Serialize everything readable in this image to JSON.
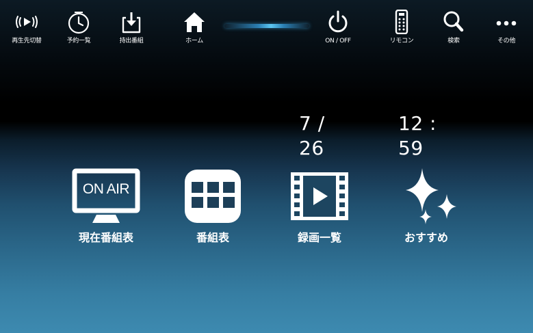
{
  "toolbar": {
    "playback_switch": {
      "label": "再生先切替",
      "icon": "playback-switch-icon"
    },
    "reservation_list": {
      "label": "予約一覧",
      "icon": "clock-icon"
    },
    "take_out": {
      "label": "持出番組",
      "icon": "export-icon"
    },
    "home": {
      "label": "ホーム",
      "icon": "home-icon"
    },
    "power": {
      "label": "ON / OFF",
      "icon": "power-icon"
    },
    "remote": {
      "label": "リモコン",
      "icon": "remote-control-icon"
    },
    "search": {
      "label": "検索",
      "icon": "search-icon"
    },
    "more": {
      "label": "その他",
      "icon": "more-icon"
    }
  },
  "status": {
    "date": "7 / 26",
    "time": "12 : 59"
  },
  "tiles": {
    "current_guide": {
      "label": "現在番組表",
      "badge": "ON AIR",
      "icon": "tv-on-air-icon"
    },
    "program_guide": {
      "label": "番組表",
      "icon": "grid-icon"
    },
    "recordings": {
      "label": "録画一覧",
      "icon": "film-play-icon"
    },
    "recommended": {
      "label": "おすすめ",
      "icon": "sparkle-icon"
    }
  },
  "colors": {
    "accent": "#4fb8e8",
    "background_top": "#0c1a24",
    "background_bottom": "#3d8ab0",
    "foreground": "#ffffff"
  }
}
